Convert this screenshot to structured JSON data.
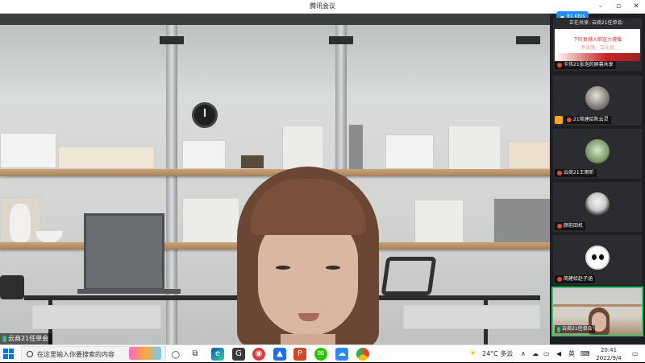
{
  "window": {
    "title": "腾讯会议",
    "controls": [
      "–",
      "▫",
      "✕"
    ]
  },
  "main": {
    "speaker_name": "云商21任单会"
  },
  "network": {
    "speed": "81 KB/s"
  },
  "sidebar": {
    "share_tile": {
      "header": "正在共享: 云商21任单会:",
      "doc_line1": "下阶复辅入职宣力遵循",
      "doc_line2": "争张强 · 立从会",
      "name": "卡伟21张泡的屏幕共享"
    },
    "participants": [
      {
        "name": "21简建给陈云灵",
        "mic": "muted",
        "avatar_icon": "cat-avatar-icon"
      },
      {
        "name": "云商21王雨昕",
        "mic": "muted",
        "avatar_icon": "plant-avatar-icon"
      },
      {
        "name": "颜前田机",
        "mic": "muted",
        "avatar_icon": "anime-avatar-icon"
      },
      {
        "name": "简建给赵子涵",
        "mic": "muted",
        "avatar_icon": "panda-avatar-icon"
      },
      {
        "name": "云商21任单会",
        "mic": "on",
        "avatar_icon": "video-thumbnail"
      }
    ]
  },
  "taskbar": {
    "search_placeholder": "在这里输入你要搜索的内容",
    "apps": [
      "task-view-icon",
      "edge-icon",
      "g-app-icon",
      "netease-music-icon",
      "tencent-meeting-icon",
      "powerpoint-icon",
      "wechat-icon",
      "baidu-netdisk-icon",
      "chrome-icon"
    ],
    "weather": "24°C 多云",
    "ime": "英",
    "time": "20:41",
    "date": "2022/9/4"
  },
  "colors": {
    "accent_green": "#35c46a",
    "mute_red": "#e24a3b",
    "windows_blue": "#0078d4",
    "net_badge_blue": "#1f8ef1"
  }
}
